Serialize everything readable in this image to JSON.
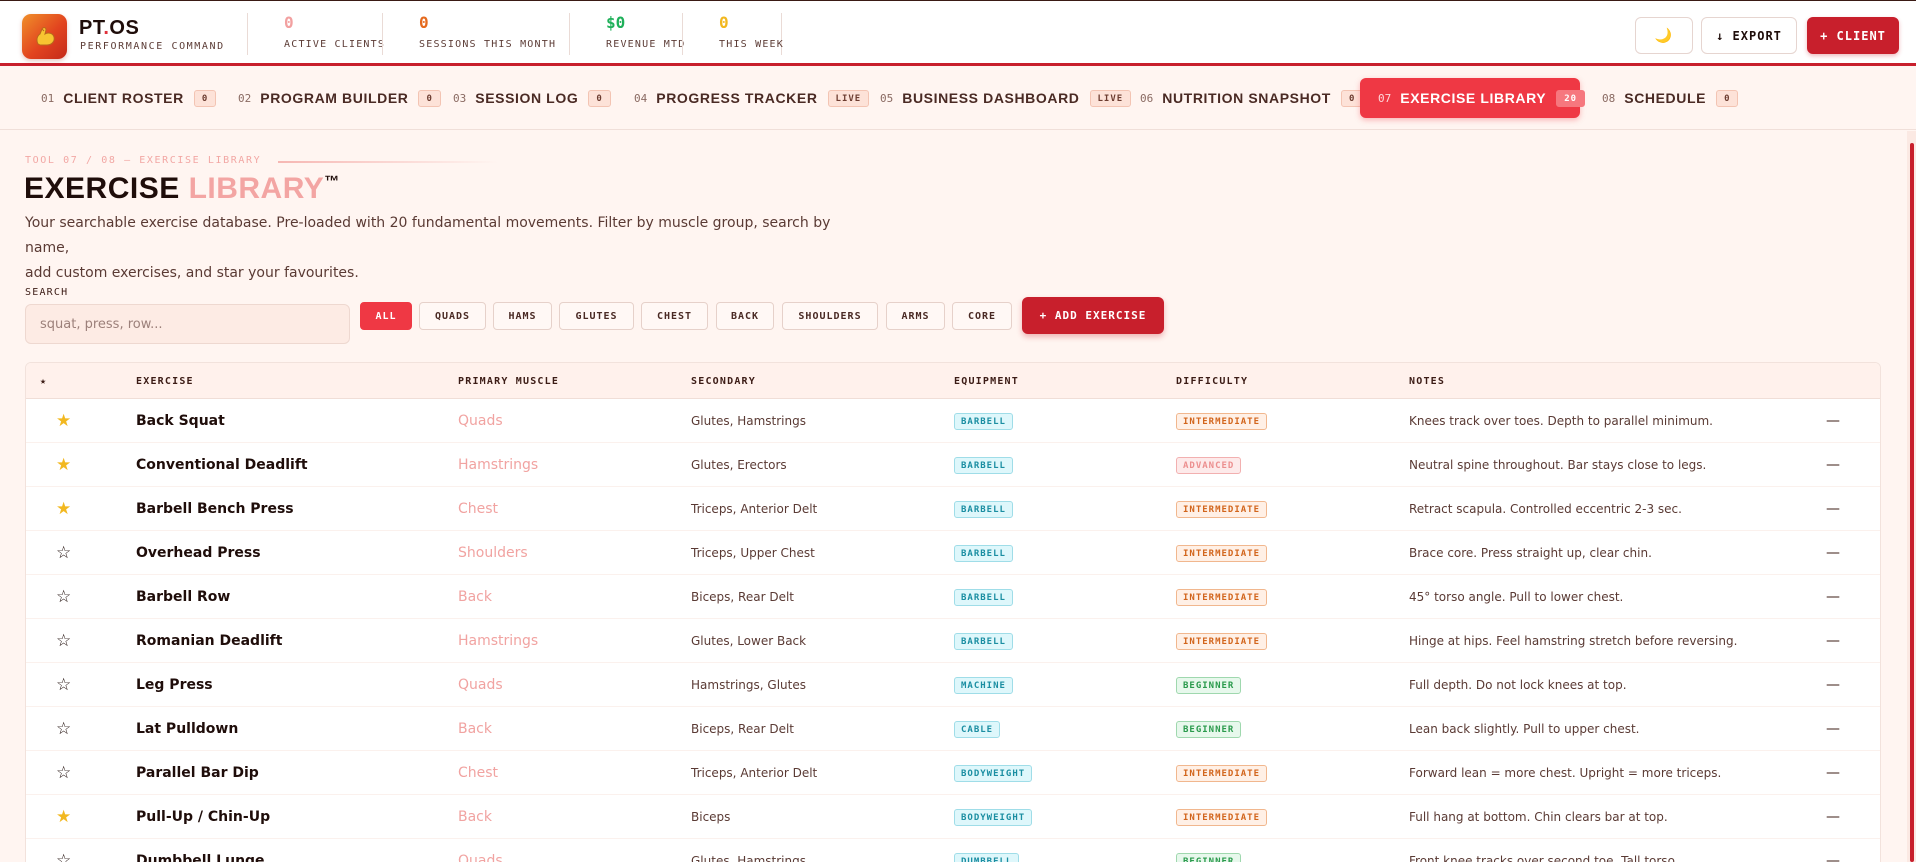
{
  "brand": {
    "name_main": "PT",
    "name_dot": ".",
    "name_end": "OS",
    "subtitle": "PERFORMANCE COMMAND",
    "logo_icon": "flexed-bicep-icon"
  },
  "stats": [
    {
      "value": "0",
      "label": "ACTIVE CLIENTS",
      "color": "#f2a0a0"
    },
    {
      "value": "0",
      "label": "SESSIONS THIS MONTH",
      "color": "#e56a1e"
    },
    {
      "value": "$0",
      "label": "REVENUE MTD",
      "color": "#1fb05a"
    },
    {
      "value": "0",
      "label": "THIS WEEK",
      "color": "#f2b820"
    }
  ],
  "header_actions": {
    "theme_icon": "moon-icon",
    "theme_glyph": "🌙",
    "export_label": "↓ EXPORT",
    "client_label": "+ CLIENT"
  },
  "tabs": [
    {
      "num": "01",
      "label": "CLIENT ROSTER",
      "badge": "0"
    },
    {
      "num": "02",
      "label": "PROGRAM BUILDER",
      "badge": "0"
    },
    {
      "num": "03",
      "label": "SESSION LOG",
      "badge": "0"
    },
    {
      "num": "04",
      "label": "PROGRESS TRACKER",
      "badge": "LIVE"
    },
    {
      "num": "05",
      "label": "BUSINESS DASHBOARD",
      "badge": "LIVE"
    },
    {
      "num": "06",
      "label": "NUTRITION SNAPSHOT",
      "badge": "0"
    },
    {
      "num": "07",
      "label": "EXERCISE LIBRARY",
      "badge": "20",
      "active": true
    },
    {
      "num": "08",
      "label": "SCHEDULE",
      "badge": "0"
    }
  ],
  "page": {
    "eyebrow": "TOOL 07 / 08 — EXERCISE LIBRARY",
    "title_main": "EXERCISE ",
    "title_accent": "LIBRARY",
    "title_tm": "™",
    "description_line1": "Your searchable exercise database. Pre-loaded with 20 fundamental movements. Filter by muscle group, search by name,",
    "description_line2": "add custom exercises, and star your favourites."
  },
  "search": {
    "label": "SEARCH",
    "placeholder": "squat, press, row...",
    "value": ""
  },
  "filters": [
    {
      "label": "ALL",
      "active": true
    },
    {
      "label": "QUADS"
    },
    {
      "label": "HAMS"
    },
    {
      "label": "GLUTES"
    },
    {
      "label": "CHEST"
    },
    {
      "label": "BACK"
    },
    {
      "label": "SHOULDERS"
    },
    {
      "label": "ARMS"
    },
    {
      "label": "CORE"
    }
  ],
  "add_exercise_label": "+ ADD EXERCISE",
  "table": {
    "columns": {
      "star": "★",
      "exercise": "EXERCISE",
      "primary": "PRIMARY MUSCLE",
      "secondary": "SECONDARY",
      "equipment": "EQUIPMENT",
      "difficulty": "DIFFICULTY",
      "notes": "NOTES"
    },
    "rows": [
      {
        "starred": true,
        "name": "Back Squat",
        "primary": "Quads",
        "secondary": "Glutes, Hamstrings",
        "equipment": "BARBELL",
        "difficulty": "INTERMEDIATE",
        "notes": "Knees track over toes. Depth to parallel minimum.",
        "action": "—"
      },
      {
        "starred": true,
        "name": "Conventional Deadlift",
        "primary": "Hamstrings",
        "secondary": "Glutes, Erectors",
        "equipment": "BARBELL",
        "difficulty": "ADVANCED",
        "notes": "Neutral spine throughout. Bar stays close to legs.",
        "action": "—"
      },
      {
        "starred": true,
        "name": "Barbell Bench Press",
        "primary": "Chest",
        "secondary": "Triceps, Anterior Delt",
        "equipment": "BARBELL",
        "difficulty": "INTERMEDIATE",
        "notes": "Retract scapula. Controlled eccentric 2-3 sec.",
        "action": "—"
      },
      {
        "starred": false,
        "name": "Overhead Press",
        "primary": "Shoulders",
        "secondary": "Triceps, Upper Chest",
        "equipment": "BARBELL",
        "difficulty": "INTERMEDIATE",
        "notes": "Brace core. Press straight up, clear chin.",
        "action": "—"
      },
      {
        "starred": false,
        "name": "Barbell Row",
        "primary": "Back",
        "secondary": "Biceps, Rear Delt",
        "equipment": "BARBELL",
        "difficulty": "INTERMEDIATE",
        "notes": "45° torso angle. Pull to lower chest.",
        "action": "—"
      },
      {
        "starred": false,
        "name": "Romanian Deadlift",
        "primary": "Hamstrings",
        "secondary": "Glutes, Lower Back",
        "equipment": "BARBELL",
        "difficulty": "INTERMEDIATE",
        "notes": "Hinge at hips. Feel hamstring stretch before reversing.",
        "action": "—"
      },
      {
        "starred": false,
        "name": "Leg Press",
        "primary": "Quads",
        "secondary": "Hamstrings, Glutes",
        "equipment": "MACHINE",
        "difficulty": "BEGINNER",
        "notes": "Full depth. Do not lock knees at top.",
        "action": "—"
      },
      {
        "starred": false,
        "name": "Lat Pulldown",
        "primary": "Back",
        "secondary": "Biceps, Rear Delt",
        "equipment": "CABLE",
        "difficulty": "BEGINNER",
        "notes": "Lean back slightly. Pull to upper chest.",
        "action": "—"
      },
      {
        "starred": false,
        "name": "Parallel Bar Dip",
        "primary": "Chest",
        "secondary": "Triceps, Anterior Delt",
        "equipment": "BODYWEIGHT",
        "difficulty": "INTERMEDIATE",
        "notes": "Forward lean = more chest. Upright = more triceps.",
        "action": "—"
      },
      {
        "starred": true,
        "name": "Pull-Up / Chin-Up",
        "primary": "Back",
        "secondary": "Biceps",
        "equipment": "BODYWEIGHT",
        "difficulty": "INTERMEDIATE",
        "notes": "Full hang at bottom. Chin clears bar at top.",
        "action": "—"
      },
      {
        "starred": false,
        "name": "Dumbbell Lunge",
        "primary": "Quads",
        "secondary": "Glutes, Hamstrings",
        "equipment": "DUMBBELL",
        "difficulty": "BEGINNER",
        "notes": "Front knee tracks over second toe. Tall torso.",
        "action": "—"
      }
    ]
  },
  "colors": {
    "accent_red": "#c81f2c",
    "active_tab": "#ef3844",
    "muscle_pink": "#f1a3a1",
    "star_gold": "#f2b820"
  }
}
